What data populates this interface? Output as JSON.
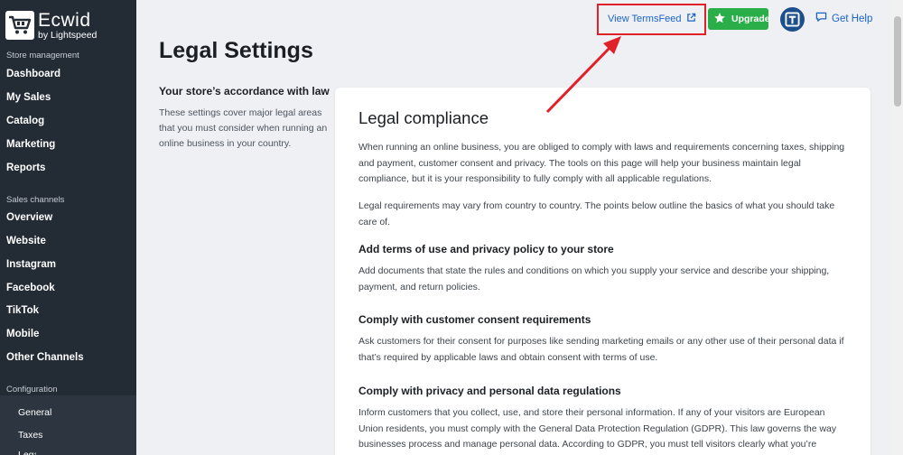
{
  "brand": {
    "name": "Ecwid",
    "sub": "by Lightspeed"
  },
  "sidebar": {
    "section_store": "Store management",
    "store_items": [
      "Dashboard",
      "My Sales",
      "Catalog",
      "Marketing",
      "Reports"
    ],
    "section_channels": "Sales channels",
    "channel_items": [
      "Overview",
      "Website",
      "Instagram",
      "Facebook",
      "TikTok",
      "Mobile",
      "Other Channels"
    ],
    "section_config": "Configuration",
    "config_items": [
      "General",
      "Taxes",
      "Legal"
    ]
  },
  "topbar": {
    "termsfeed_label": "View TermsFeed",
    "upgrade_label": "Upgrade",
    "help_label": "Get Help"
  },
  "page": {
    "title": "Legal Settings",
    "left_heading": "Your store’s accordance with law",
    "left_text": "These settings cover major legal areas that you must consider when running an online business in your country."
  },
  "card": {
    "title": "Legal compliance",
    "intro": "When running an online business, you are obliged to comply with laws and requirements concerning taxes, shipping and payment, customer consent and privacy. The tools on this page will help your business maintain legal compliance, but it is your responsibility to fully comply with all applicable regulations.",
    "intro2": "Legal requirements may vary from country to country. The points below outline the basics of what you should take care of.",
    "h1": "Add terms of use and privacy policy to your store",
    "p1": "Add documents that state the rules and conditions on which you supply your service and describe your shipping, payment, and return policies.",
    "h2": "Comply with customer consent requirements",
    "p2": "Ask customers for their consent for purposes like sending marketing emails or any other use of their personal data if that’s required by applicable laws and obtain consent with terms of use.",
    "h3": "Comply with privacy and personal data regulations",
    "p3": "Inform customers that you collect, use, and store their personal information. If any of your visitors are European Union residents, you must comply with the General Data Protection Regulation (GDPR). This law governs the way businesses process and manage personal data. According to GDPR, you must tell visitors clearly what you’re"
  },
  "colors": {
    "sidebar": "#232b35",
    "accent": "#1b63c7",
    "upgrade": "#2aae4a",
    "highlight": "#e0212a"
  }
}
